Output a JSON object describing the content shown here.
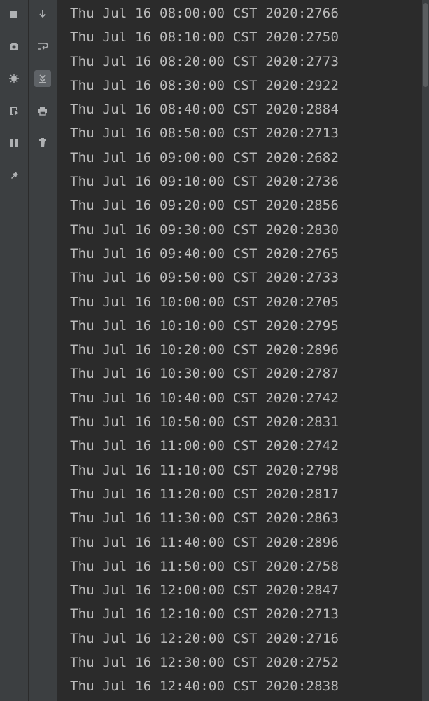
{
  "sidebar_a": {
    "items": [
      {
        "name": "stop-icon"
      },
      {
        "name": "camera-icon"
      },
      {
        "name": "debug-icon"
      },
      {
        "name": "export-icon"
      },
      {
        "name": "layout-icon"
      },
      {
        "name": "pin-icon"
      }
    ]
  },
  "sidebar_b": {
    "items": [
      {
        "name": "arrow-down-icon"
      },
      {
        "name": "soft-wrap-icon"
      },
      {
        "name": "scroll-to-end-icon",
        "active": true
      },
      {
        "name": "print-icon"
      },
      {
        "name": "trash-icon"
      }
    ]
  },
  "console": {
    "lines": [
      "Thu Jul 16 08:00:00 CST 2020:2766",
      "Thu Jul 16 08:10:00 CST 2020:2750",
      "Thu Jul 16 08:20:00 CST 2020:2773",
      "Thu Jul 16 08:30:00 CST 2020:2922",
      "Thu Jul 16 08:40:00 CST 2020:2884",
      "Thu Jul 16 08:50:00 CST 2020:2713",
      "Thu Jul 16 09:00:00 CST 2020:2682",
      "Thu Jul 16 09:10:00 CST 2020:2736",
      "Thu Jul 16 09:20:00 CST 2020:2856",
      "Thu Jul 16 09:30:00 CST 2020:2830",
      "Thu Jul 16 09:40:00 CST 2020:2765",
      "Thu Jul 16 09:50:00 CST 2020:2733",
      "Thu Jul 16 10:00:00 CST 2020:2705",
      "Thu Jul 16 10:10:00 CST 2020:2795",
      "Thu Jul 16 10:20:00 CST 2020:2896",
      "Thu Jul 16 10:30:00 CST 2020:2787",
      "Thu Jul 16 10:40:00 CST 2020:2742",
      "Thu Jul 16 10:50:00 CST 2020:2831",
      "Thu Jul 16 11:00:00 CST 2020:2742",
      "Thu Jul 16 11:10:00 CST 2020:2798",
      "Thu Jul 16 11:20:00 CST 2020:2817",
      "Thu Jul 16 11:30:00 CST 2020:2863",
      "Thu Jul 16 11:40:00 CST 2020:2896",
      "Thu Jul 16 11:50:00 CST 2020:2758",
      "Thu Jul 16 12:00:00 CST 2020:2847",
      "Thu Jul 16 12:10:00 CST 2020:2713",
      "Thu Jul 16 12:20:00 CST 2020:2716",
      "Thu Jul 16 12:30:00 CST 2020:2752",
      "Thu Jul 16 12:40:00 CST 2020:2838"
    ]
  }
}
